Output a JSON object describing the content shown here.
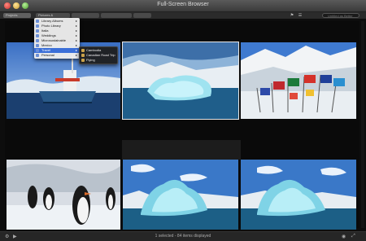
{
  "window": {
    "title": "Full-Screen Browser"
  },
  "toolbar": {
    "breadcrumbs": [
      "Projects",
      "Pictures & Panoramas",
      "",
      "",
      ""
    ],
    "search_placeholder": "Untitled as Better"
  },
  "menu": {
    "items": [
      {
        "label": "Library Albums"
      },
      {
        "label": "Photo Library"
      },
      {
        "label": "Italia"
      },
      {
        "label": "Weddings"
      },
      {
        "label": "Microsustainable"
      },
      {
        "label": "Mexico"
      },
      {
        "label": "Travel"
      },
      {
        "label": "Personal"
      }
    ],
    "highlighted_index": 6
  },
  "submenu": {
    "items": [
      {
        "label": "Cambodia"
      },
      {
        "label": "Canadian Road Trip"
      },
      {
        "label": "Flying"
      }
    ]
  },
  "grid": {
    "photos": [
      {
        "subject": "research ship"
      },
      {
        "subject": "iceberg",
        "selected": true
      },
      {
        "subject": "flags"
      },
      {
        "subject": "penguins"
      },
      {
        "subject": "iceberg"
      },
      {
        "subject": "iceberg"
      }
    ]
  },
  "status": {
    "text": "1 selected - 84 items displayed"
  }
}
